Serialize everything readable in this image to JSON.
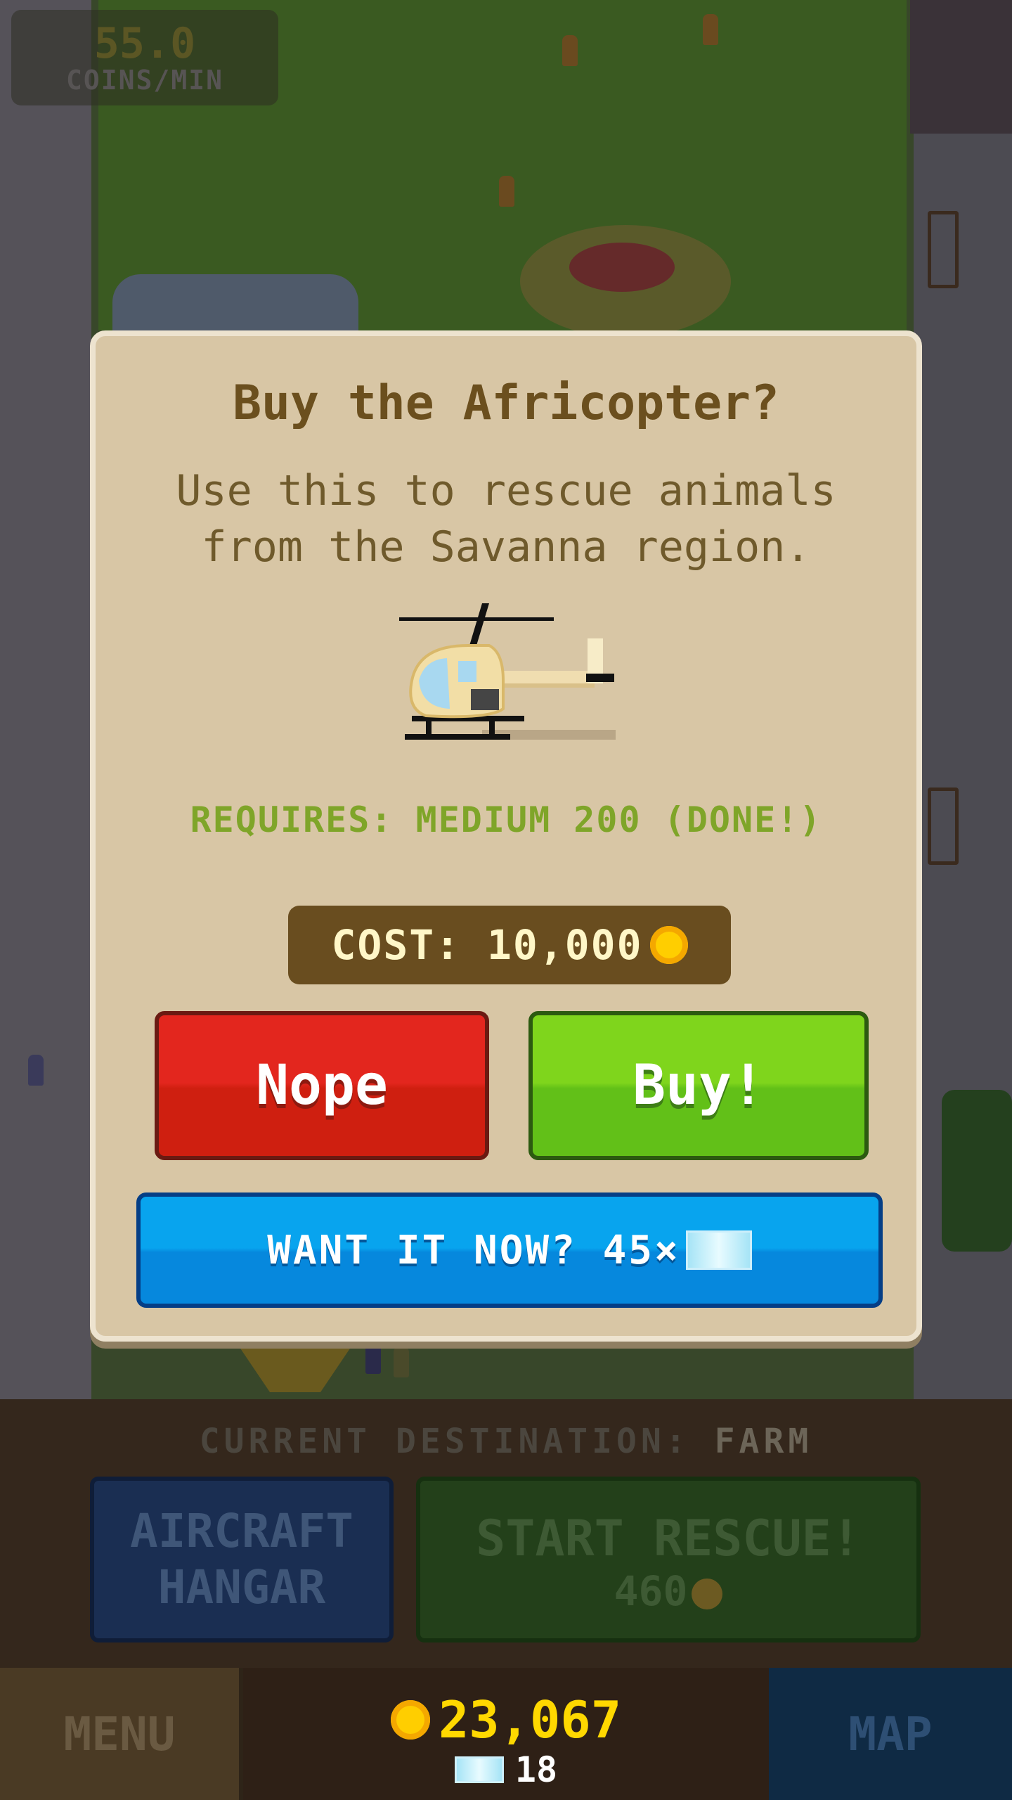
{
  "hud": {
    "coins_per_min_value": "55.0",
    "coins_per_min_unit": "COINS/MIN"
  },
  "dialog": {
    "title": "Buy the Africopter?",
    "description": "Use this to rescue animals from the Savanna region.",
    "requirement": "REQUIRES: MEDIUM 200 (DONE!)",
    "cost_label": "COST: 10,000",
    "nope_label": "Nope",
    "buy_label": "Buy!",
    "instant_label": "WANT IT NOW? 45×"
  },
  "bottom": {
    "destination_prefix": "CURRENT DESTINATION: ",
    "destination_value": "FARM",
    "hangar_label": "AIRCRAFT\nHANGAR",
    "rescue_label": "START RESCUE!",
    "rescue_cost": "460"
  },
  "bar": {
    "menu_label": "MENU",
    "coins": "23,067",
    "gems": "18",
    "map_label": "MAP"
  },
  "colors": {
    "nope": "#e3261e",
    "buy": "#7fd51c",
    "instant": "#08a4ee",
    "coin": "#ffce00",
    "dialog_bg": "#d8c6a5"
  }
}
